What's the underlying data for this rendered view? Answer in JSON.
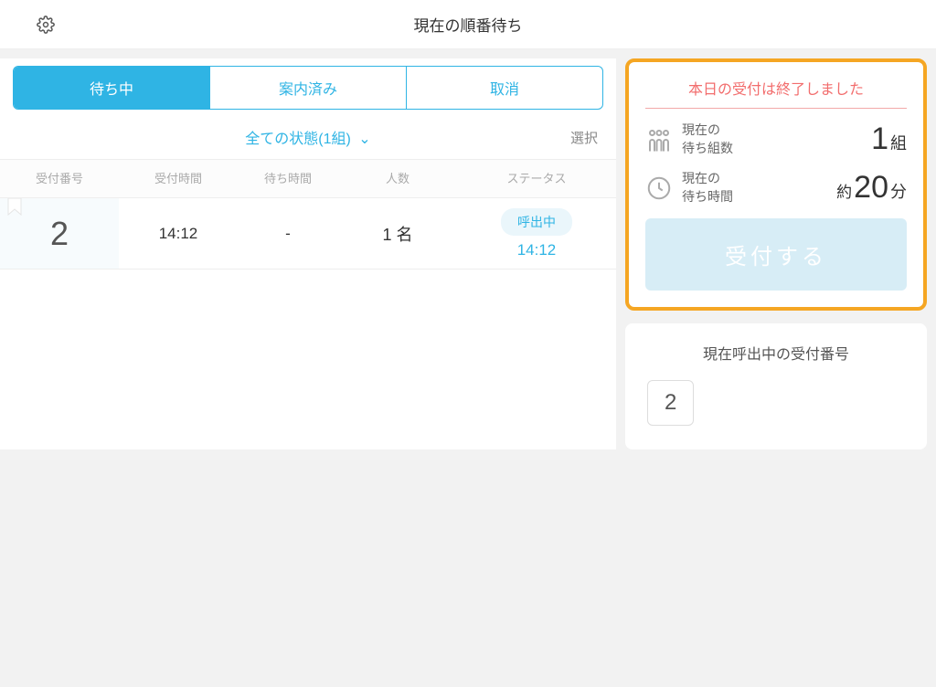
{
  "header": {
    "title": "現在の順番待ち"
  },
  "tabs": [
    "待ち中",
    "案内済み",
    "取消"
  ],
  "filter": {
    "label": "全ての状態(1組)",
    "select": "選択"
  },
  "columns": {
    "number": "受付番号",
    "accept_time": "受付時間",
    "wait_time": "待ち時間",
    "people": "人数",
    "status": "ステータス"
  },
  "rows": [
    {
      "number": "2",
      "accept_time": "14:12",
      "wait_time": "-",
      "people": "1 名",
      "status_label": "呼出中",
      "status_time": "14:12"
    }
  ],
  "summary": {
    "closed_msg": "本日の受付は終了しました",
    "groups_label1": "現在の",
    "groups_label2": "待ち組数",
    "groups_value": "1",
    "groups_unit": "組",
    "wait_label1": "現在の",
    "wait_label2": "待ち時間",
    "wait_prefix": "約",
    "wait_value": "20",
    "wait_unit": "分",
    "accept_button": "受付する"
  },
  "calling": {
    "title": "現在呼出中の受付番号",
    "number": "2"
  }
}
